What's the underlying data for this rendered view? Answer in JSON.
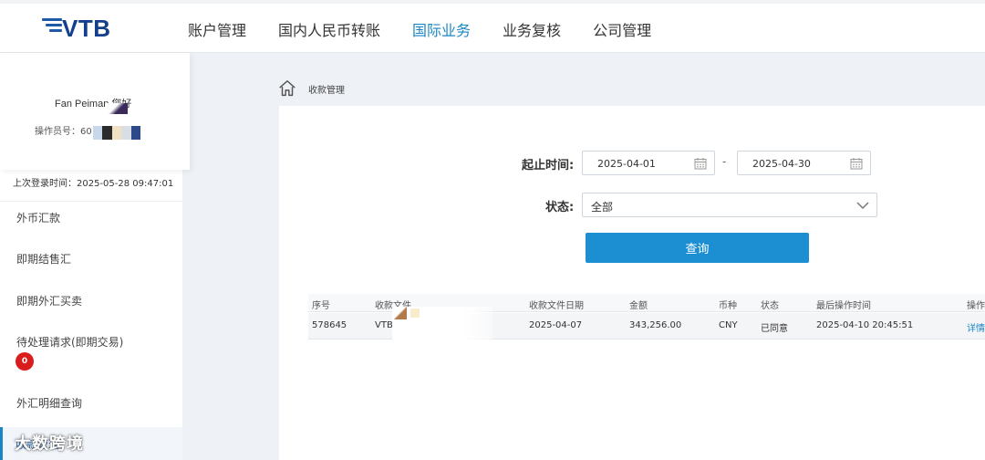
{
  "header": {
    "logo_text": "VTB",
    "nav": [
      {
        "label": "账户管理",
        "active": false
      },
      {
        "label": "国内人民币转账",
        "active": false
      },
      {
        "label": "国际业务",
        "active": true
      },
      {
        "label": "业务复核",
        "active": false
      },
      {
        "label": "公司管理",
        "active": false
      }
    ]
  },
  "sidebar": {
    "greeting": "Fan Peiman 您好",
    "operator_label": "操作员号：60",
    "last_login": "上次登录时间：2025-05-28 09:47:01",
    "items": [
      {
        "label": "外币汇款"
      },
      {
        "label": "即期结售汇"
      },
      {
        "label": "即期外汇买卖"
      },
      {
        "label": "待处理请求(即期交易)",
        "badge": "0"
      },
      {
        "label": "外汇明细查询"
      },
      {
        "label": "收款管理",
        "active": true
      }
    ],
    "watermark": "大数跨境"
  },
  "breadcrumb": {
    "current": "收款管理"
  },
  "filters": {
    "date_label": "起止时间:",
    "date_from": "2025-04-01",
    "date_sep": "-",
    "date_to": "2025-04-30",
    "status_label": "状态:",
    "status_value": "全部",
    "query_button": "查询"
  },
  "table": {
    "columns": [
      "序号",
      "收款文件",
      "收款文件日期",
      "金额",
      "币种",
      "状态",
      "最后操作时间",
      "操作"
    ],
    "rows": [
      {
        "id": "578645",
        "file": "VTB",
        "file_date": "2025-04-07",
        "amount": "343,256.00",
        "currency": "CNY",
        "status": "已同意",
        "last_op_time": "2025-04-10 20:45:51",
        "action": "详情"
      }
    ]
  },
  "colors": {
    "accent": "#1b86c4",
    "button": "#1b8fd2",
    "logo": "#143f8c",
    "badge": "#d91c1c"
  }
}
